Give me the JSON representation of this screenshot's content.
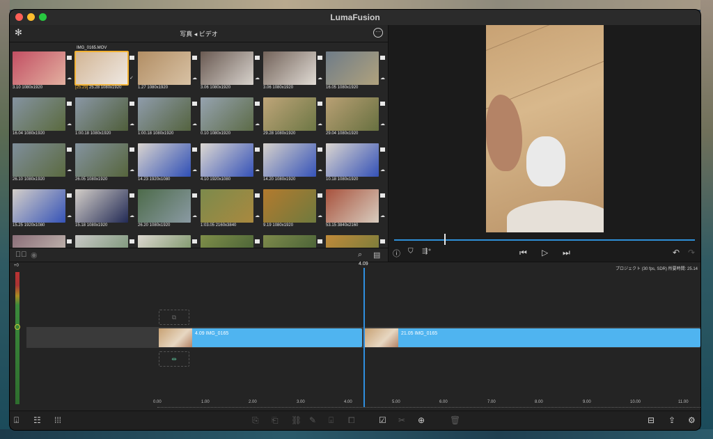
{
  "window": {
    "title": "LumaFusion"
  },
  "library": {
    "title": "写真 ◂ ビデオ",
    "selected_title": "IMG_0165.MOV",
    "rows": [
      [
        {
          "dur": "3.10",
          "res": "1080x1920",
          "c1": "#c24f63",
          "c2": "#e3b0a0"
        },
        {
          "dur": "[25.29]",
          "res": "25.28  1080x1920",
          "c1": "#d2b594",
          "c2": "#efe9e4",
          "selected": true
        },
        {
          "dur": "1.27",
          "res": "1080x1920",
          "c1": "#b28e64",
          "c2": "#d8c2a5"
        },
        {
          "dur": "3.06",
          "res": "1080x1920",
          "c1": "#6a5a52",
          "c2": "#d7d2cc"
        },
        {
          "dur": "3.06",
          "res": "1080x1920",
          "c1": "#73635a",
          "c2": "#e0dbd4"
        },
        {
          "dur": "16.05",
          "res": "1080x1920",
          "c1": "#6f7c88",
          "c2": "#b0a27d"
        }
      ],
      [
        {
          "dur": "16.04",
          "res": "1080x1920",
          "c1": "#8593a1",
          "c2": "#5a6a3e"
        },
        {
          "dur": "1:00.18",
          "res": "1080x1920",
          "c1": "#8a97a5",
          "c2": "#4f5e3a"
        },
        {
          "dur": "1:00.18",
          "res": "1080x1920",
          "c1": "#8f9cab",
          "c2": "#54633f"
        },
        {
          "dur": "0.10",
          "res": "1080x1920",
          "c1": "#96a3b0",
          "c2": "#5c6b47"
        },
        {
          "dur": "29.28",
          "res": "1080x1920",
          "c1": "#bfa579",
          "c2": "#6d7745"
        },
        {
          "dur": "29.04",
          "res": "1080x1920",
          "c1": "#b9a074",
          "c2": "#677040"
        }
      ],
      [
        {
          "dur": "26.10",
          "res": "1080x1920",
          "c1": "#7f8e9b",
          "c2": "#5b6a40"
        },
        {
          "dur": "26.05",
          "res": "1080x1920",
          "c1": "#84939f",
          "c2": "#56653c"
        },
        {
          "dur": "14.23",
          "res": "1920x1080",
          "c1": "#d9d4cf",
          "c2": "#2f4fb6"
        },
        {
          "dur": "4.10",
          "res": "1920x1080",
          "c1": "#ddd8d2",
          "c2": "#3552b8"
        },
        {
          "dur": "14.20",
          "res": "1080x1920",
          "c1": "#d6d1cb",
          "c2": "#3654b9"
        },
        {
          "dur": "10.18",
          "res": "1080x1920",
          "c1": "#dbd6d0",
          "c2": "#3451b7"
        }
      ],
      [
        {
          "dur": "15.25",
          "res": "1920x1080",
          "c1": "#d4cfc9",
          "c2": "#3553b7"
        },
        {
          "dur": "15.18",
          "res": "1080x1920",
          "c1": "#d3cec8",
          "c2": "#222a55"
        },
        {
          "dur": "26.20",
          "res": "1080x1920",
          "c1": "#4d6b4a",
          "c2": "#8a9aa3"
        },
        {
          "dur": "1:03.05",
          "res": "2160x3840",
          "c1": "#7c8a4c",
          "c2": "#a9893f"
        },
        {
          "dur": "9.19",
          "res": "1080x1920",
          "c1": "#b37a2e",
          "c2": "#6f7a3e"
        },
        {
          "dur": "53.15",
          "res": "3840x2160",
          "c1": "#a8523d",
          "c2": "#d8cdbf"
        }
      ],
      [
        {
          "dur": "",
          "res": "",
          "c1": "#8c6f79",
          "c2": "#c9c2b8"
        },
        {
          "dur": "",
          "res": "",
          "c1": "#c9c8c6",
          "c2": "#6d8d6a"
        },
        {
          "dur": "",
          "res": "",
          "c1": "#dcd7d0",
          "c2": "#6a8a55"
        },
        {
          "dur": "",
          "res": "",
          "c1": "#7f8e49",
          "c2": "#3f5a33"
        },
        {
          "dur": "",
          "res": "",
          "c1": "#7e8a4b",
          "c2": "#3d5932"
        },
        {
          "dur": "",
          "res": "",
          "c1": "#c08a3a",
          "c2": "#6a7a3c"
        }
      ]
    ]
  },
  "timeline": {
    "playhead_label": "4.09",
    "project_info": "プロジェクト (30 fps, SDR) 所要時間: 25.14",
    "meter_top": "+0",
    "clips": [
      {
        "label": "4.09   IMG_0165"
      },
      {
        "label": "21.05   IMG_0165"
      }
    ],
    "ticks": [
      "0.00",
      "1.00",
      "2.00",
      "3.00",
      "4.00",
      "5.00",
      "6.00",
      "7.00",
      "8.00",
      "9.00",
      "10.00",
      "11.00"
    ]
  },
  "icons": {
    "library_left": "gear-icon",
    "library_right": "more-icon"
  },
  "colors": {
    "accent_blue": "#4fb4f0",
    "selection": "#f2b233",
    "playhead": "#2f8fe0"
  }
}
